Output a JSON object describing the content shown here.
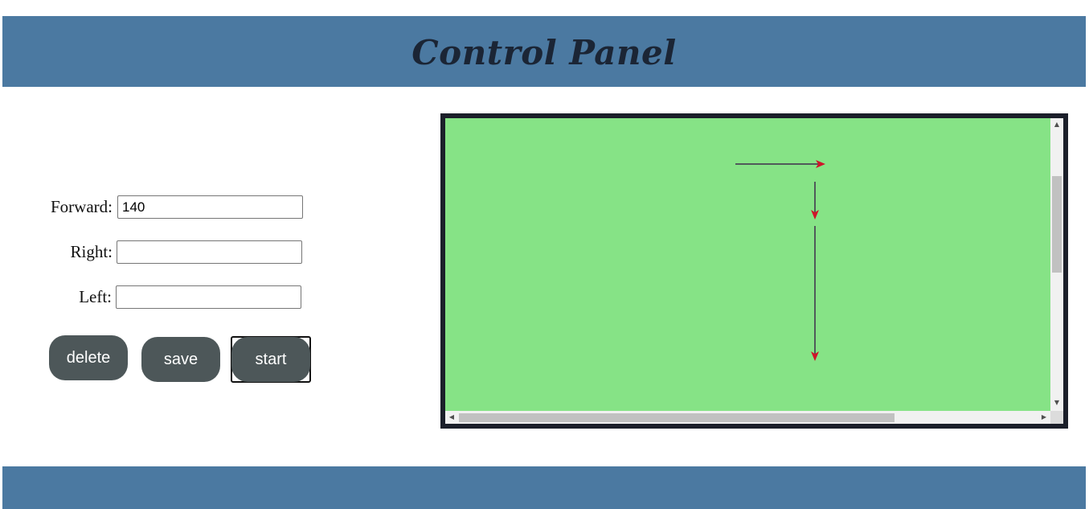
{
  "header": {
    "title": "Control Panel"
  },
  "form": {
    "forward": {
      "label": "Forward:",
      "value": "140"
    },
    "right": {
      "label": "Right:",
      "value": ""
    },
    "left": {
      "label": "Left:",
      "value": ""
    }
  },
  "buttons": {
    "delete_label": "delete",
    "save_label": "save",
    "start_label": "start"
  },
  "canvas": {
    "background_color": "#86e386",
    "line_color": "#505a5a",
    "arrowhead_color": "#d0142a"
  },
  "colors": {
    "header_bg": "#4b79a1",
    "button_bg": "#4d5759",
    "canvas_border": "#1b1f2a"
  },
  "icons": {
    "scroll_up": "triangle-up-icon",
    "scroll_down": "triangle-down-icon",
    "scroll_left": "triangle-left-icon",
    "scroll_right": "triangle-right-icon"
  }
}
